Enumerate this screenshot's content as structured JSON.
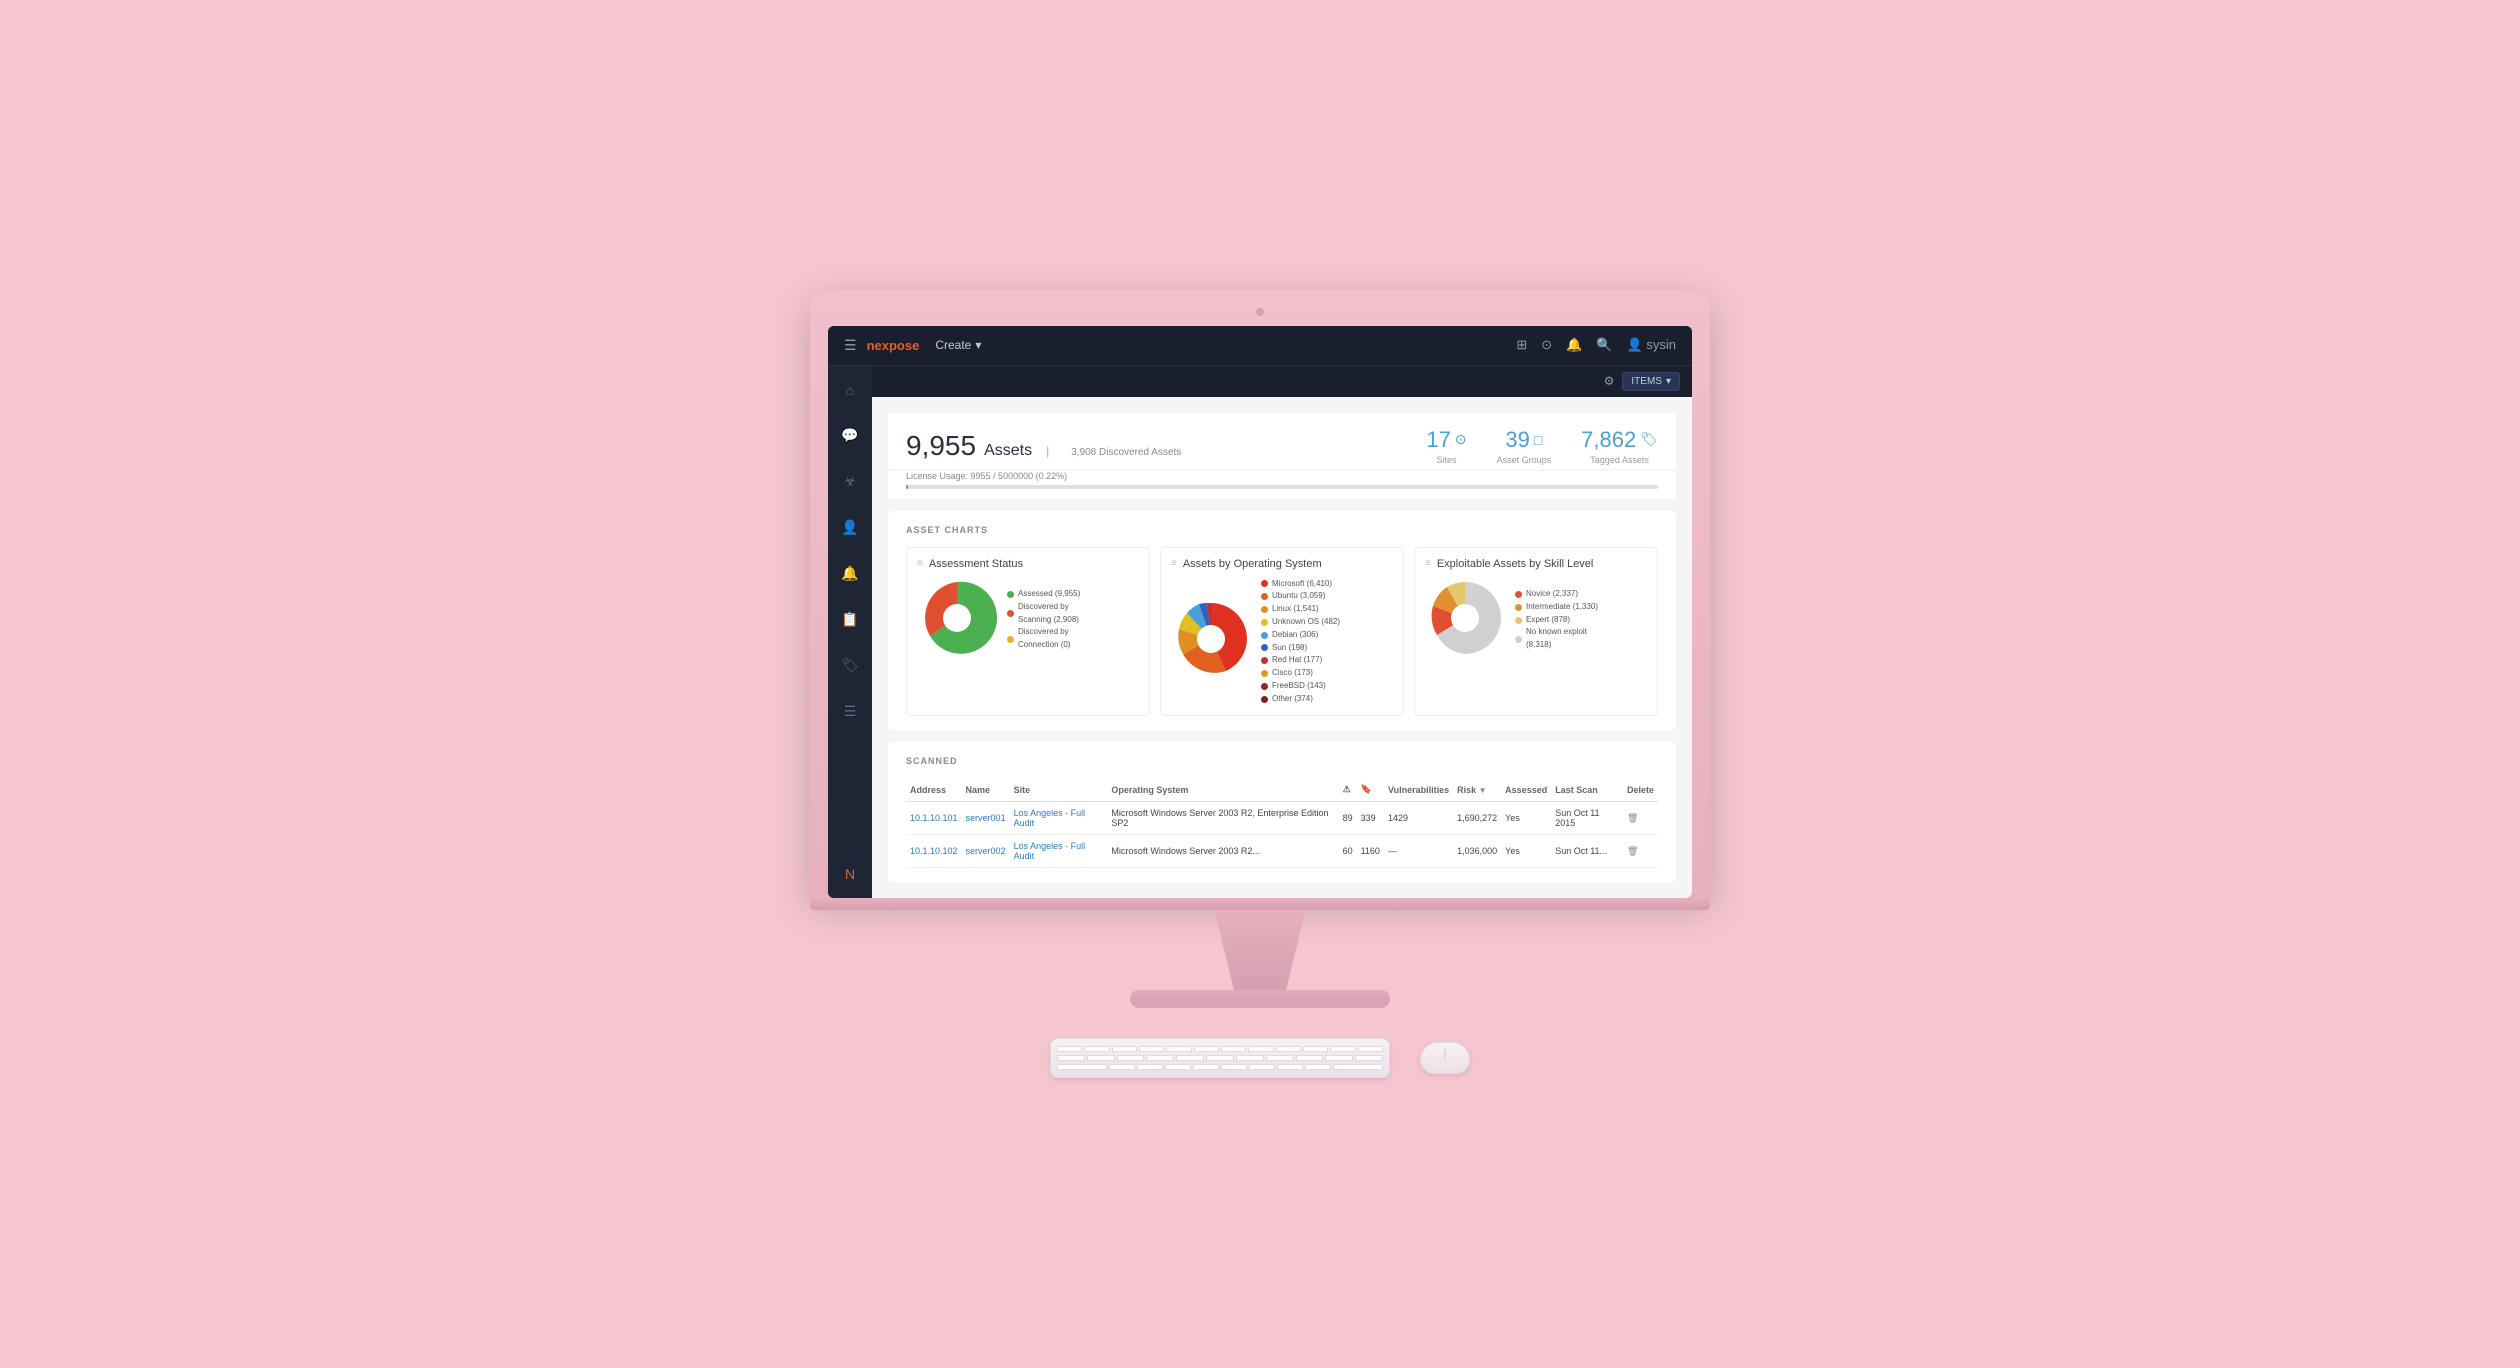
{
  "app": {
    "name": "nexpose",
    "nav": {
      "create_label": "Create",
      "create_arrow": "▾",
      "items_btn": "ITEMS",
      "items_arrow": "▾"
    }
  },
  "header": {
    "assets_count": "9,955",
    "assets_label": "Assets",
    "discovered_label": "3,908 Discovered Assets",
    "sites_count": "17",
    "sites_label": "Sites",
    "asset_groups_count": "39",
    "asset_groups_label": "Asset Groups",
    "tagged_assets_count": "7,862",
    "tagged_assets_label": "Tagged Assets",
    "license_text": "License Usage: 9955 / 5000000 (0.22%)"
  },
  "charts": {
    "section_label": "ASSET CHARTS",
    "chart1": {
      "title": "Assessment Status",
      "legend": [
        {
          "label": "Assessed (9,955)",
          "color": "#4CAF50"
        },
        {
          "label": "Discovered by Scanning (2,908)",
          "color": "#e05030"
        },
        {
          "label": "Discovered by Connection (0)",
          "color": "#e0b030"
        }
      ]
    },
    "chart2": {
      "title": "Assets by Operating System",
      "legend": [
        {
          "label": "Microsoft (6,410)",
          "color": "#e03020"
        },
        {
          "label": "Ubuntu (3,059)",
          "color": "#e06020"
        },
        {
          "label": "Linux (1,541)",
          "color": "#e09020"
        },
        {
          "label": "Unknown OS (482)",
          "color": "#e0c020"
        },
        {
          "label": "Debian (306)",
          "color": "#4a9fd4"
        },
        {
          "label": "Sun (198)",
          "color": "#3060c0"
        },
        {
          "label": "Red Hat (177)",
          "color": "#c03030"
        },
        {
          "label": "Cisco (173)",
          "color": "#d4a020"
        },
        {
          "label": "FreeBSD (143)",
          "color": "#a02020"
        },
        {
          "label": "Other (374)",
          "color": "#802020"
        }
      ]
    },
    "chart3": {
      "title": "Exploitable Assets by Skill Level",
      "legend": [
        {
          "label": "Novice (2,337)",
          "color": "#e05030"
        },
        {
          "label": "Intermediate (1,330)",
          "color": "#e09030"
        },
        {
          "label": "Expert (878)",
          "color": "#e0c870"
        },
        {
          "label": "No known exploit (8,318)",
          "color": "#d0d0d0"
        }
      ]
    }
  },
  "table": {
    "section_label": "SCANNED",
    "columns": [
      "Address",
      "Name",
      "Site",
      "Operating System",
      "",
      "",
      "Vulnerabilities",
      "Risk ▼",
      "Assessed",
      "Last Scan",
      "Delete"
    ],
    "rows": [
      {
        "address": "10.1.10.101",
        "name": "server001",
        "site": "Los Angeles - Full Audit",
        "os": "Microsoft Windows Server 2003 R2, Enterprise Edition SP2",
        "vuln": "89",
        "count": "339",
        "risk": "1429",
        "risk2": "1,690,272",
        "assessed": "Yes",
        "last_scan": "Sun Oct 11 2015",
        "delete": "🗑"
      },
      {
        "address": "10.1.10.102",
        "name": "server002",
        "site": "Los Angeles - Full Audit",
        "os": "Microsoft Windows Server 2003 R2...",
        "vuln": "60",
        "count": "1160",
        "risk": "1,036,000",
        "risk2": "",
        "assessed": "Yes",
        "last_scan": "Sun Oct 11...",
        "delete": "🗑"
      }
    ]
  }
}
